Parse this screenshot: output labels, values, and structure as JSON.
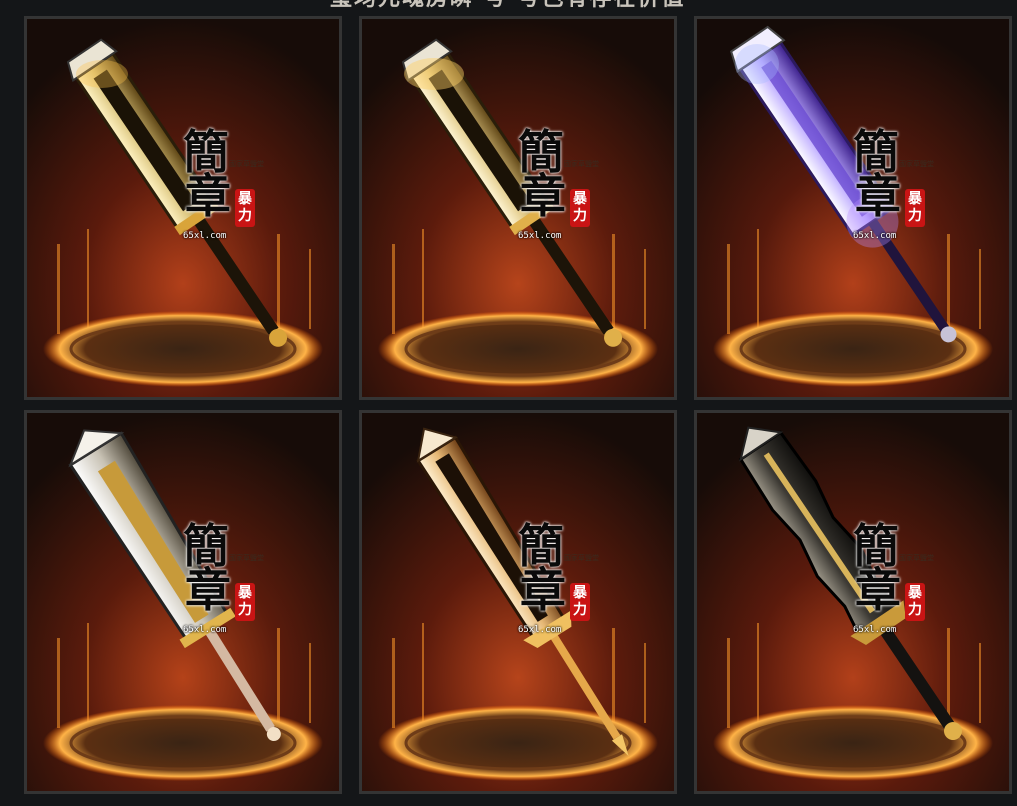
{
  "header": {
    "title": "玺均元魂房瞬 号 号色有存在价值"
  },
  "colors": {
    "background": "#141618",
    "tile_border": "#343434",
    "fire_glow": "#ff8a1c",
    "seal_red": "#c91414"
  },
  "watermark": {
    "char_top": "簡",
    "char_bottom": "章",
    "seal_text": "暴力",
    "small_text": "國家草鹽堂",
    "domain": "65xl.com"
  },
  "weapons": [
    {
      "variant": "golden-greatsword"
    },
    {
      "variant": "golden-greatsword-flame"
    },
    {
      "variant": "arcane-purple-greatsword"
    },
    {
      "variant": "silver-gold-broadsword"
    },
    {
      "variant": "ornate-gold-blade"
    },
    {
      "variant": "dark-spiked-greatsword"
    }
  ]
}
